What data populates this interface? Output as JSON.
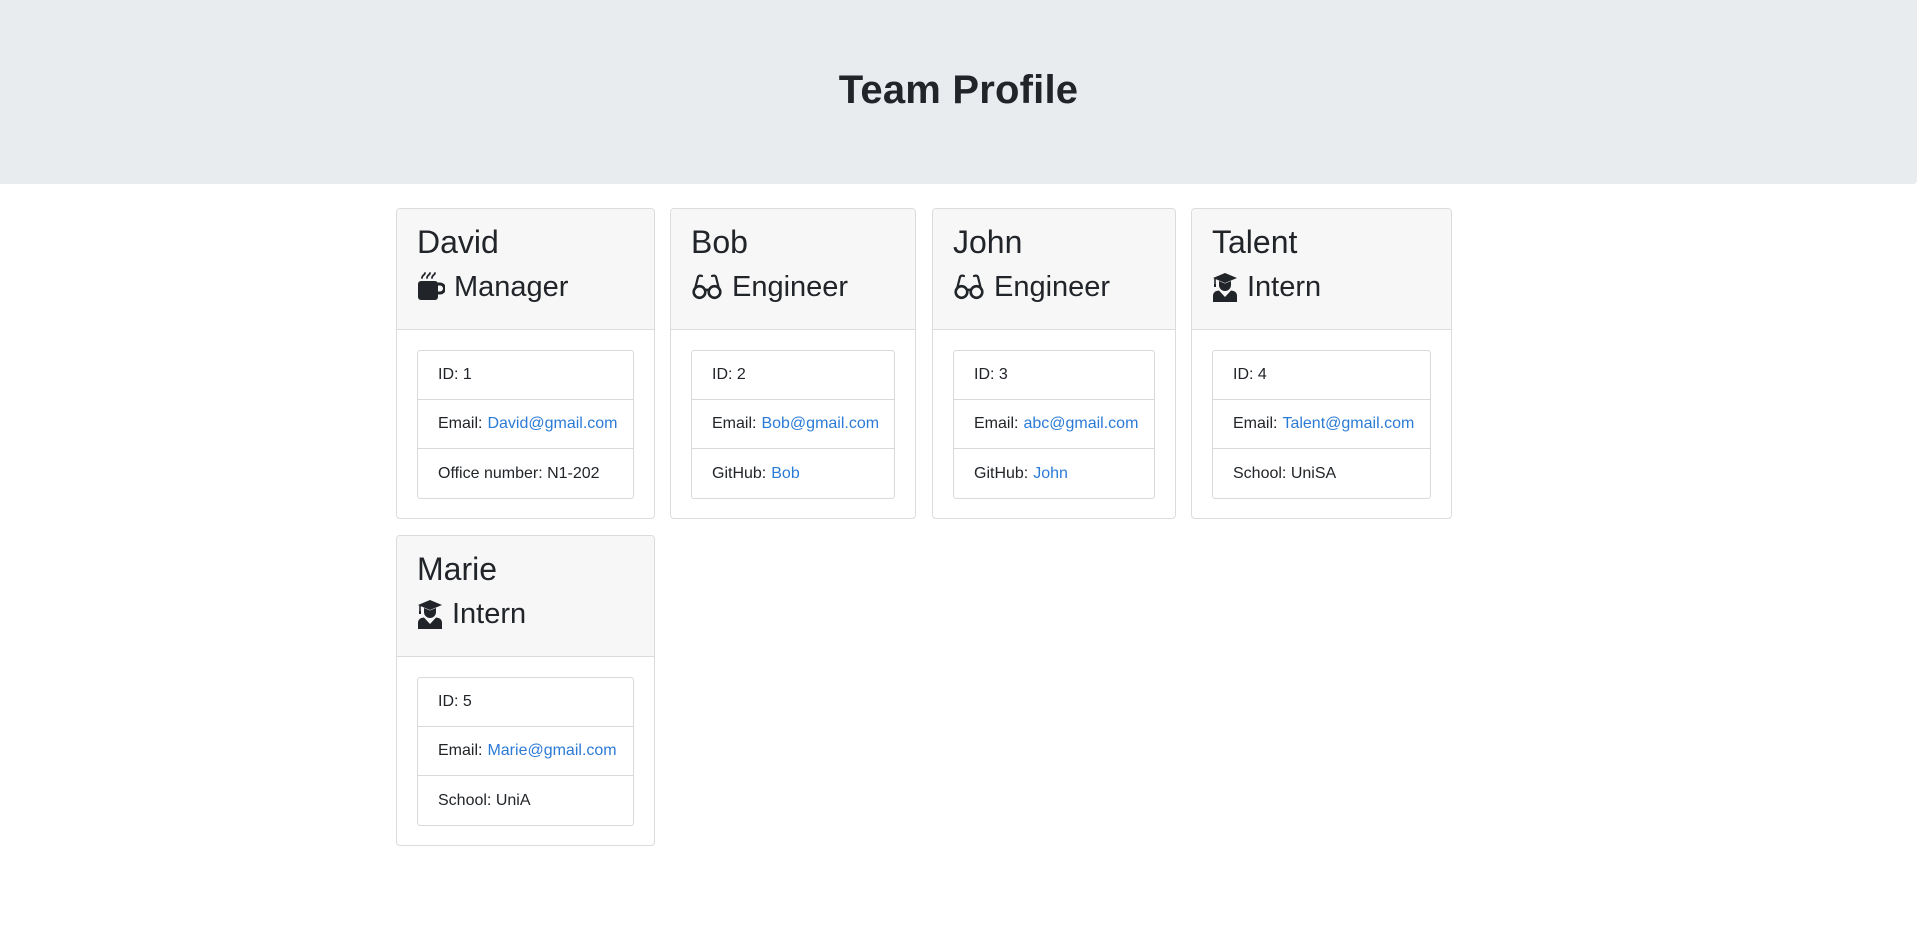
{
  "header": {
    "title": "Team Profile"
  },
  "colors": {
    "jumbotron_bg": "#e9ecef",
    "card_header_bg": "#f7f7f7",
    "link": "#2b7bd6",
    "text": "#212529"
  },
  "team": [
    {
      "name": "David",
      "role": "Manager",
      "icon": "mug-icon",
      "id_label": "ID: 1",
      "email_label": "Email:",
      "email": "David@gmail.com",
      "extra_label": "Office number: N1-202",
      "extra_link": ""
    },
    {
      "name": "Bob",
      "role": "Engineer",
      "icon": "glasses-icon",
      "id_label": "ID: 2",
      "email_label": "Email:",
      "email": "Bob@gmail.com",
      "extra_label": "GitHub:",
      "extra_link": "Bob"
    },
    {
      "name": "John",
      "role": "Engineer",
      "icon": "glasses-icon",
      "id_label": "ID: 3",
      "email_label": "Email:",
      "email": "abc@gmail.com",
      "extra_label": "GitHub:",
      "extra_link": "John"
    },
    {
      "name": "Talent",
      "role": "Intern",
      "icon": "graduate-icon",
      "id_label": "ID: 4",
      "email_label": "Email:",
      "email": "Talent@gmail.com",
      "extra_label": "School: UniSA",
      "extra_link": ""
    },
    {
      "name": "Marie",
      "role": "Intern",
      "icon": "graduate-icon",
      "id_label": "ID: 5",
      "email_label": "Email:",
      "email": "Marie@gmail.com",
      "extra_label": "School: UniA",
      "extra_link": ""
    }
  ]
}
